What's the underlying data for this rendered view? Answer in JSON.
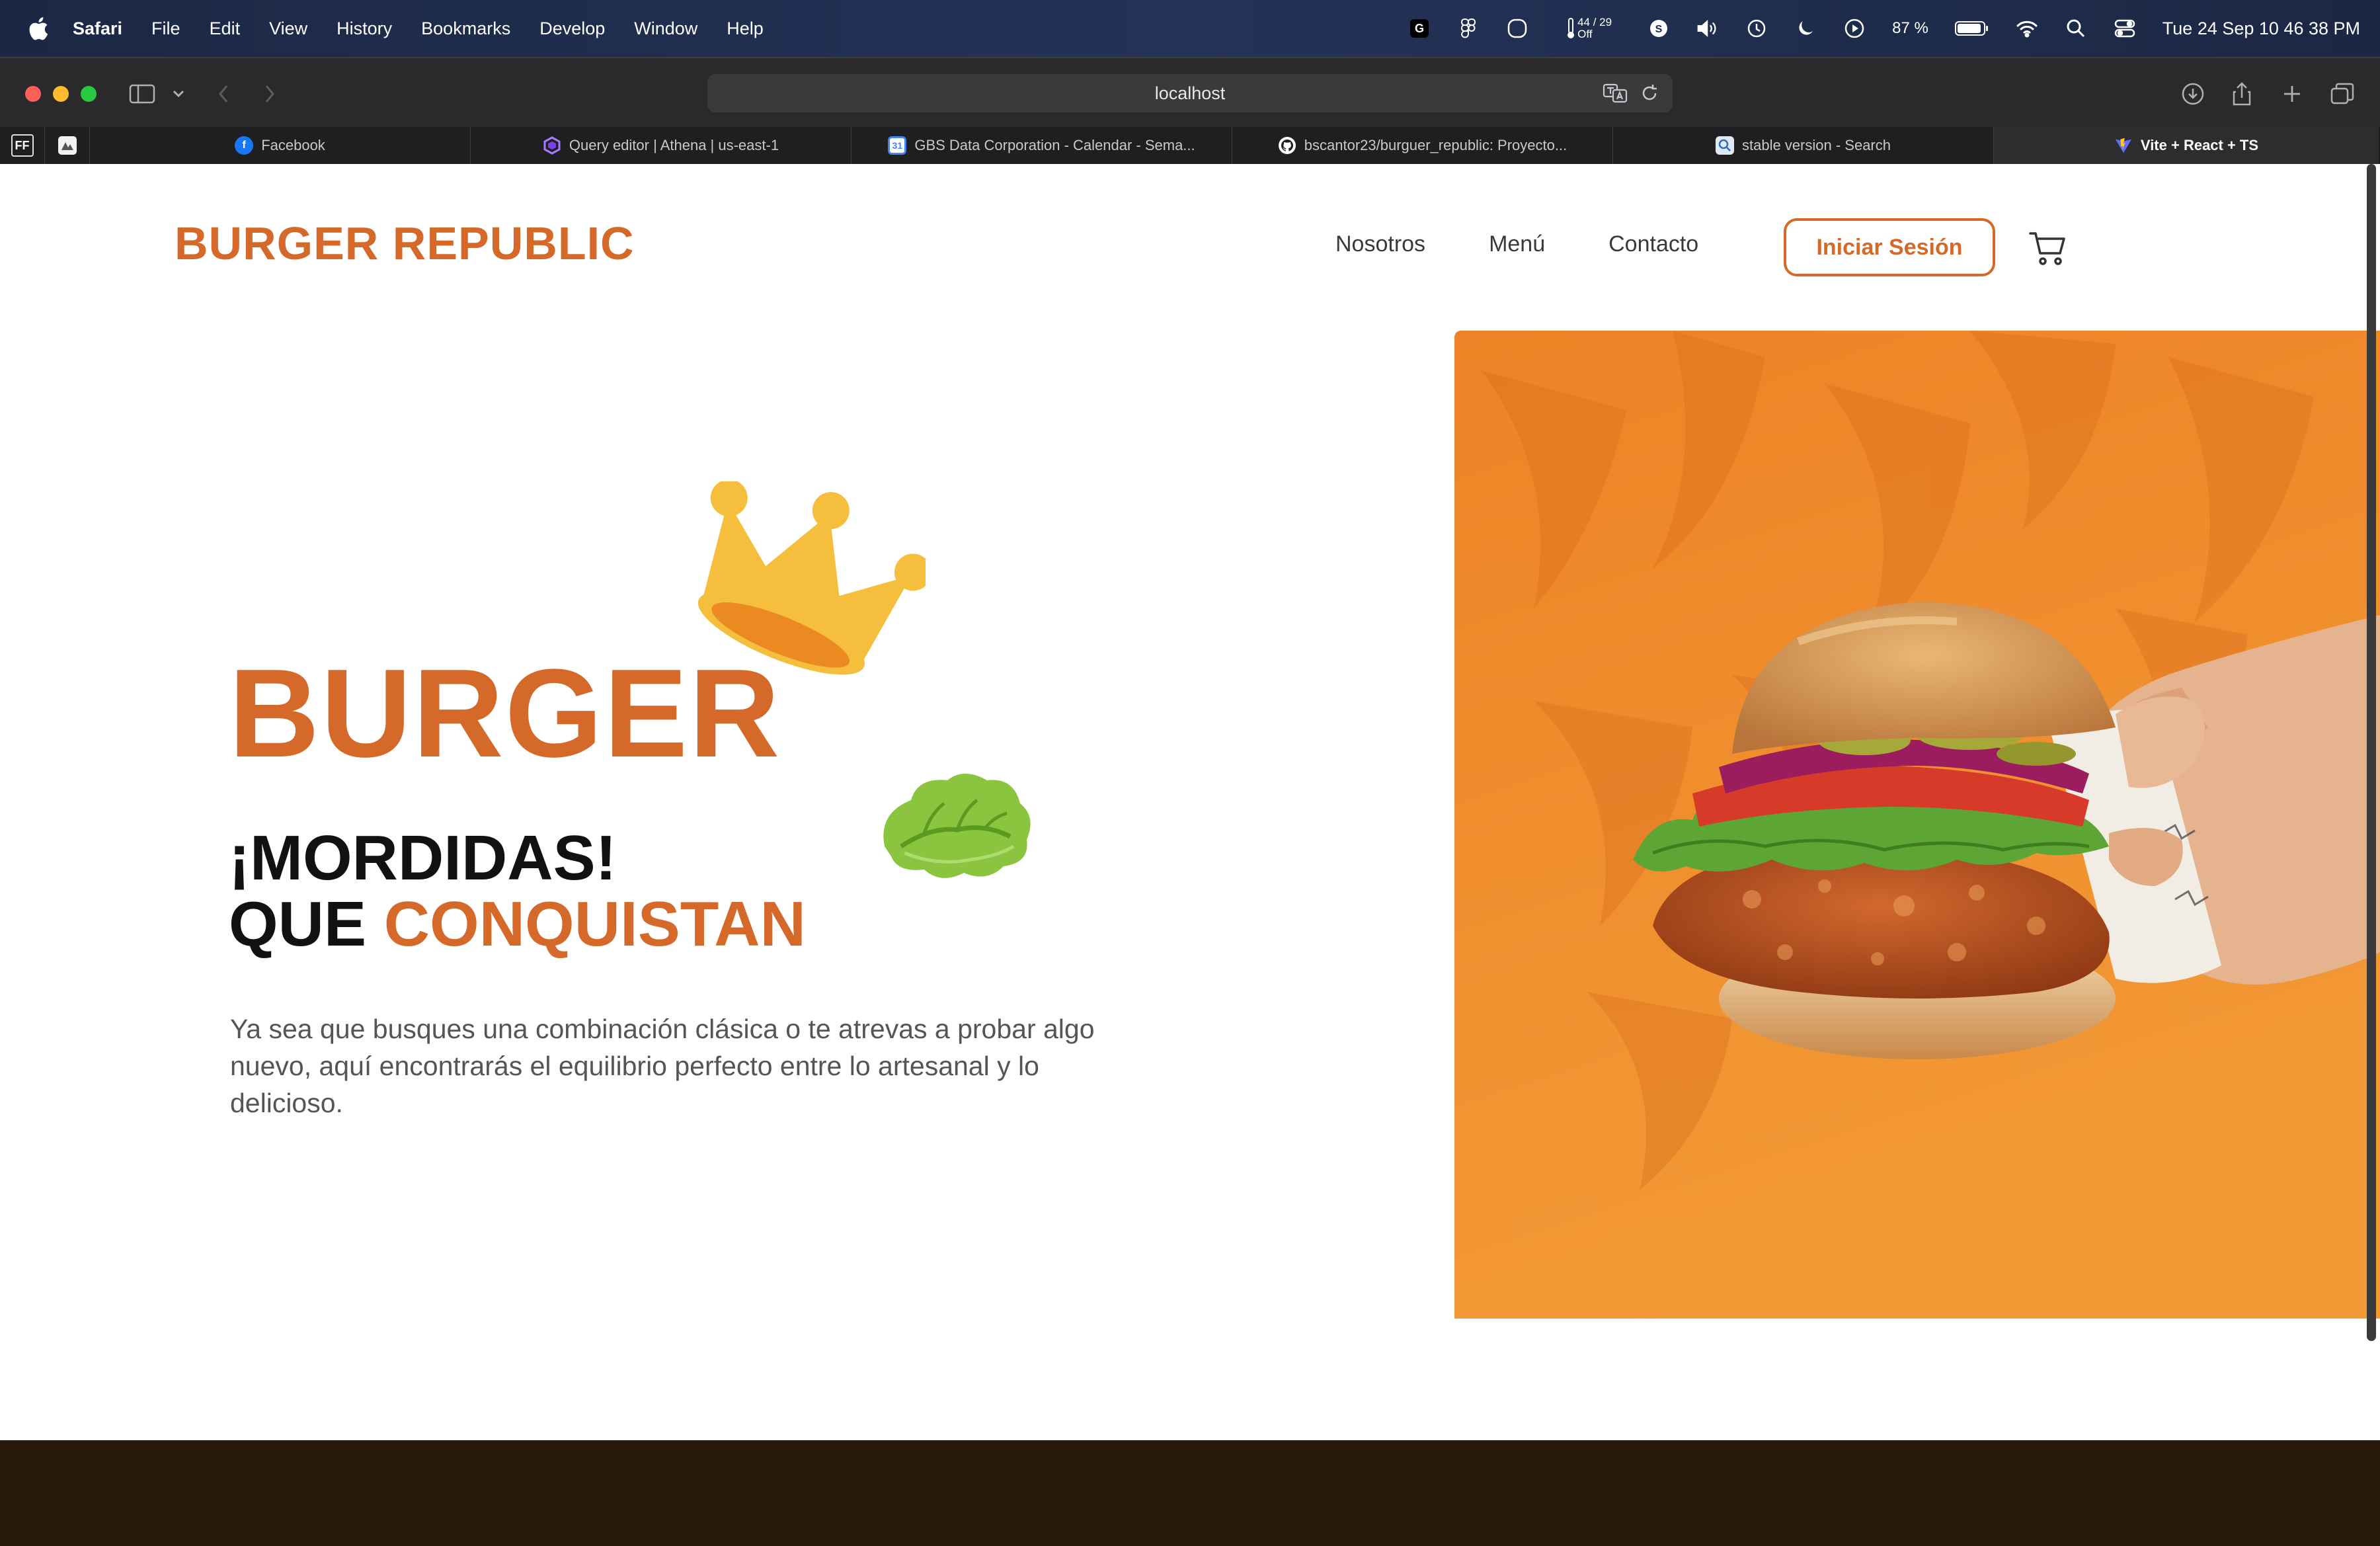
{
  "menubar": {
    "app_name": "Safari",
    "items": [
      "File",
      "Edit",
      "View",
      "History",
      "Bookmarks",
      "Develop",
      "Window",
      "Help"
    ],
    "temp_line1": "44 / 29",
    "temp_line2": "Off",
    "battery": "87 %",
    "clock": "Tue 24 Sep  10 46 38 PM"
  },
  "browser": {
    "url": "localhost",
    "tabs": [
      {
        "label": "Facebook",
        "icon": "facebook-icon",
        "color": "#1877f2"
      },
      {
        "label": "Query editor | Athena | us-east-1",
        "icon": "athena-icon",
        "color": "#8c4fff"
      },
      {
        "label": "GBS Data Corporation - Calendar - Sema...",
        "icon": "calendar-icon",
        "color": "#4285f4"
      },
      {
        "label": "bscantor23/burguer_republic: Proyecto...",
        "icon": "github-icon",
        "color": "#ffffff"
      },
      {
        "label": "stable version - Search",
        "icon": "search-icon",
        "color": "#4a90d9"
      },
      {
        "label": "Vite + React + TS",
        "icon": "vite-icon",
        "color": "#646cff"
      }
    ],
    "pinned_tab": "FF"
  },
  "site": {
    "brand": "BURGER REPUBLIC",
    "nav": [
      "Nosotros",
      "Menú",
      "Contacto"
    ],
    "login": "Iniciar Sesión",
    "hero_title": "BURGER",
    "hero_sub_line1": "¡MORDIDAS!",
    "hero_sub_line2_plain": "QUE ",
    "hero_sub_line2_accent": "CONQUISTAN",
    "hero_text": "Ya sea que busques una combinación clásica o te atrevas a probar algo nuevo, aquí encontrarás el equilibrio perfecto entre lo artesanal y lo delicioso."
  },
  "colors": {
    "accent": "#d4692a",
    "footer": "#2a1a0c",
    "hero_bg": "#f08a2a"
  }
}
